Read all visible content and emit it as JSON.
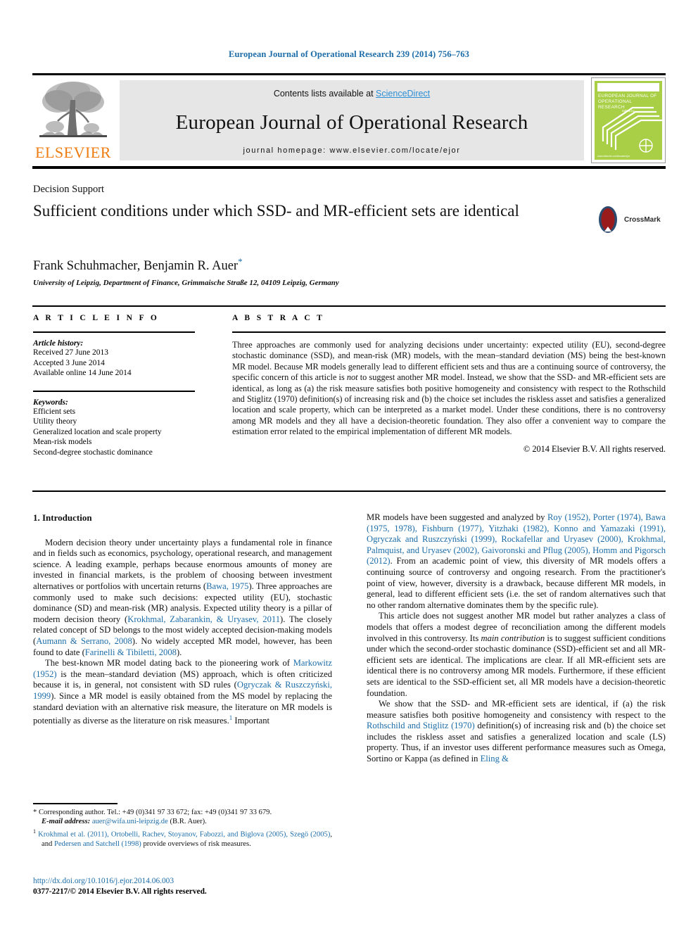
{
  "running_head": "European Journal of Operational Research 239 (2014) 756–763",
  "masthead": {
    "contents_prefix": "Contents lists available at ",
    "sciencedirect": "ScienceDirect",
    "journal_name": "European Journal of Operational Research",
    "homepage": "journal homepage: www.elsevier.com/locate/ejor",
    "publisher_wordmark": "ELSEVIER",
    "cover": {
      "title": "EUROPEAN JOURNAL OF OPERATIONAL RESEARCH",
      "subtitle": "Edited by",
      "footer": "www.elsevier.com/locate/ejor"
    }
  },
  "title_block": {
    "kicker": "Decision Support",
    "title": "Sufficient conditions under which SSD- and MR-efficient sets are identical",
    "authors": "Frank Schuhmacher, Benjamin R. Auer",
    "corresponding_marker": "*",
    "affiliation": "University of Leipzig, Department of Finance, Grimmaische Straße 12, 04109 Leipzig, Germany",
    "crossmark_label": "CrossMark"
  },
  "article_info": {
    "heading": "A R T I C L E   I N F O",
    "history_label": "Article history:",
    "history": [
      "Received 27 June 2013",
      "Accepted 3 June 2014",
      "Available online 14 June 2014"
    ],
    "keywords_label": "Keywords:",
    "keywords": [
      "Efficient sets",
      "Utility theory",
      "Generalized location and scale property",
      "Mean-risk models",
      "Second-degree stochastic dominance"
    ]
  },
  "abstract": {
    "heading": "A B S T R A C T",
    "body": "Three approaches are commonly used for analyzing decisions under uncertainty: expected utility (EU), second-degree stochastic dominance (SSD), and mean-risk (MR) models, with the mean–standard deviation (MS) being the best-known MR model. Because MR models generally lead to different efficient sets and thus are a continuing source of controversy, the specific concern of this article is ",
    "body_italic": "not",
    "body_cont": " to suggest another MR model. Instead, we show that the SSD- and MR-efficient sets are identical, as long as (a) the risk measure satisfies both positive homogeneity and consistency with respect to the Rothschild and Stiglitz (1970) definition(s) of increasing risk and (b) the choice set includes the riskless asset and satisfies a generalized location and scale property, which can be interpreted as a market model. Under these conditions, there is no controversy among MR models and they all have a decision-theoretic foundation. They also offer a convenient way to compare the estimation error related to the empirical implementation of different MR models.",
    "copyright": "© 2014 Elsevier B.V. All rights reserved."
  },
  "body": {
    "section_heading": "1. Introduction",
    "left_paragraphs": [
      {
        "parts": [
          {
            "t": "Modern decision theory under uncertainty plays a fundamental role in finance and in fields such as economics, psychology, operational research, and management science. A leading example, perhaps because enormous amounts of money are invested in financial markets, is the problem of choosing between investment alternatives or portfolios with uncertain returns ("
          },
          {
            "t": "Bawa, 1975",
            "ref": true
          },
          {
            "t": "). Three approaches are commonly used to make such decisions: expected utility (EU), stochastic dominance (SD) and mean-risk (MR) analysis. Expected utility theory is a pillar of modern decision theory ("
          },
          {
            "t": "Krokhmal, Zabarankin, & Uryasev, 2011",
            "ref": true
          },
          {
            "t": "). The closely related concept of SD belongs to the most widely accepted decision-making models ("
          },
          {
            "t": "Aumann & Serrano, 2008",
            "ref": true
          },
          {
            "t": "). No widely accepted MR model, however, has been found to date ("
          },
          {
            "t": "Farinelli & Tibiletti, 2008",
            "ref": true
          },
          {
            "t": ")."
          }
        ]
      },
      {
        "parts": [
          {
            "t": "The best-known MR model dating back to the pioneering work of "
          },
          {
            "t": "Markowitz (1952)",
            "ref": true
          },
          {
            "t": " is the mean–standard deviation (MS) approach, which is often criticized because it is, in general, not consistent with SD rules ("
          },
          {
            "t": "Ogryczak & Ruszczyński, 1999",
            "ref": true
          },
          {
            "t": "). Since a MR model is easily obtained from the MS model by replacing the standard deviation with an alternative risk measure, the literature on MR models is potentially as diverse as the literature on risk measures."
          },
          {
            "t": "1",
            "sup": true
          },
          {
            "t": " Important"
          }
        ]
      }
    ],
    "right_paragraphs": [
      {
        "parts": [
          {
            "t": "MR models have been suggested and analyzed by "
          },
          {
            "t": "Roy (1952), Porter (1974), Bawa (1975, 1978), Fishburn (1977), Yitzhaki (1982), Konno and Yamazaki (1991), Ogryczak and Ruszczyński (1999), Rockafellar and Uryasev (2000), Krokhmal, Palmquist, and Uryasev (2002), Gaivoronski and Pflug (2005), Homm and Pigorsch (2012)",
            "ref": true
          },
          {
            "t": ". From an academic point of view, this diversity of MR models offers a continuing source of controversy and ongoing research. From the practitioner's point of view, however, diversity is a drawback, because different MR models, in general, lead to different efficient sets (i.e. the set of random alternatives such that no other random alternative dominates them by the specific rule)."
          }
        ],
        "indent": false
      },
      {
        "parts": [
          {
            "t": "This article does not suggest another MR model but rather analyzes a class of models that offers a modest degree of reconciliation among the different models involved in this controversy. Its "
          },
          {
            "t": "main contribution",
            "em": true
          },
          {
            "t": " is to suggest sufficient conditions under which the second-order stochastic dominance (SSD)-efficient set and all MR-efficient sets are identical. The implications are clear. If all MR-efficient sets are identical there is no controversy among MR models. Furthermore, if these efficient sets are identical to the SSD-efficient set, all MR models have a decision-theoretic foundation."
          }
        ]
      },
      {
        "parts": [
          {
            "t": "We show that the SSD- and MR-efficient sets are identical, if (a) the risk measure satisfies both positive homogeneity and consistency with respect to the "
          },
          {
            "t": "Rothschild and Stiglitz (1970)",
            "ref": true
          },
          {
            "t": " definition(s) of increasing risk and (b) the choice set includes the riskless asset and satisfies a generalized location and scale (LS) property. Thus, if an investor uses different performance measures such as Omega, Sortino or Kappa (as defined in "
          },
          {
            "t": "Eling &",
            "ref": true
          }
        ]
      }
    ]
  },
  "footnotes": [
    {
      "marker": "*",
      "parts": [
        {
          "t": " Corresponding author. Tel.: +49 (0)341 97 33 672; fax: +49 (0)341 97 33 679."
        },
        {
          "t": "BREAK"
        },
        {
          "t": "E-mail address:",
          "em": true
        },
        {
          "t": " "
        },
        {
          "t": "auer@wifa.uni-leipzig.de",
          "ref": true
        },
        {
          "t": " (B.R. Auer)."
        }
      ]
    },
    {
      "marker": "1",
      "superscript": true,
      "parts": [
        {
          "t": " "
        },
        {
          "t": "Krokhmal et al. (2011), Ortobelli, Rachev, Stoyanov, Fabozzi, and Biglova (2005), Szegö (2005)",
          "ref": true
        },
        {
          "t": ", and "
        },
        {
          "t": "Pedersen and Satchell (1998)",
          "ref": true
        },
        {
          "t": " provide overviews of risk measures."
        }
      ]
    }
  ],
  "bottom_meta": {
    "doi": "http://dx.doi.org/10.1016/j.ejor.2014.06.003",
    "issn_line": "0377-2217/© 2014 Elsevier B.V. All rights reserved."
  },
  "colors": {
    "link_blue": "#1b6ca8",
    "sciencedirect_blue": "#2d8fd5",
    "elsevier_orange": "#ef7c10",
    "cover_green": "#a8cf45",
    "masthead_gray": "#e6e6e6"
  }
}
